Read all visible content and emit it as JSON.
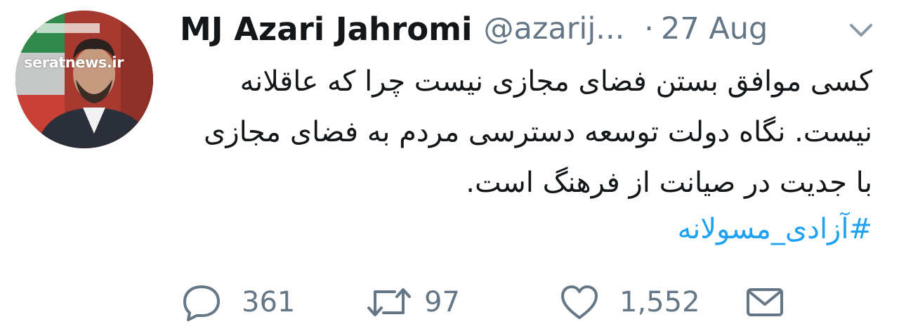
{
  "tweet": {
    "author_name": "MJ Azari Jahromi",
    "handle": "@azarij...",
    "separator": "·",
    "date": "27 Aug",
    "text": "کسی موافق بستن فضای مجازی نیست چرا که عاقلانه نیست. نگاه دولت توسعه دسترسی مردم به فضای مجازی با جدیت در صیانت از فرهنگ است.",
    "hashtag": "#آزادی_مسولانه",
    "avatar_watermark": "seratnews.ir"
  },
  "actions": {
    "reply_count": "361",
    "retweet_count": "97",
    "like_count": "1,552"
  },
  "icons": {
    "reply": "speech-bubble-icon",
    "retweet": "retweet-arrows-icon",
    "like": "heart-icon",
    "message": "envelope-icon",
    "menu": "chevron-down-icon"
  },
  "colors": {
    "text": "#14171a",
    "muted": "#657786",
    "link": "#1da1f2",
    "background": "#ffffff"
  }
}
